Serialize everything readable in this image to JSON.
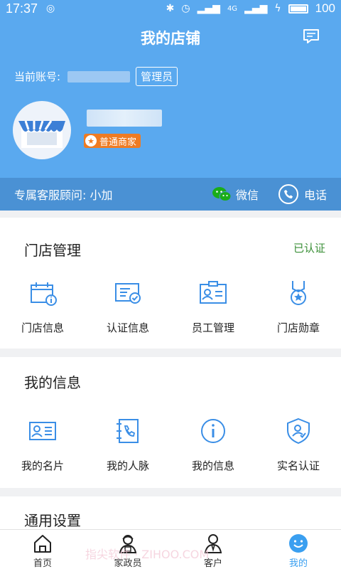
{
  "status_bar": {
    "time": "17:37",
    "battery": "100",
    "network": "4G"
  },
  "header": {
    "title": "我的店铺",
    "account_label": "当前账号:",
    "role_badge": "管理员",
    "merchant_badge": "普通商家"
  },
  "service": {
    "advisor": "专属客服顾问: 小加",
    "wechat": "微信",
    "phone": "电话"
  },
  "store_management": {
    "title": "门店管理",
    "status": "已认证",
    "items": [
      {
        "label": "门店信息",
        "icon": "store-info-icon"
      },
      {
        "label": "认证信息",
        "icon": "certificate-icon"
      },
      {
        "label": "员工管理",
        "icon": "staff-card-icon"
      },
      {
        "label": "门店勋章",
        "icon": "medal-icon"
      }
    ]
  },
  "my_info": {
    "title": "我的信息",
    "items": [
      {
        "label": "我的名片",
        "icon": "business-card-icon"
      },
      {
        "label": "我的人脉",
        "icon": "contacts-icon"
      },
      {
        "label": "我的信息",
        "icon": "info-icon"
      },
      {
        "label": "实名认证",
        "icon": "verified-user-icon"
      }
    ]
  },
  "general_settings": {
    "title": "通用设置"
  },
  "tabbar": [
    {
      "label": "首页",
      "icon": "home-icon"
    },
    {
      "label": "家政员",
      "icon": "housekeeper-icon"
    },
    {
      "label": "客户",
      "icon": "customer-icon"
    },
    {
      "label": "我的",
      "icon": "smiley-icon"
    }
  ],
  "watermark": "指尖软件 · ZIHOO.COM",
  "colors": {
    "header_blue": "#5aa9ef",
    "service_blue": "#4a91d4",
    "accent": "#3a9ff0",
    "verified_green": "#3a8f37",
    "merchant_orange": "#ef7b22"
  }
}
